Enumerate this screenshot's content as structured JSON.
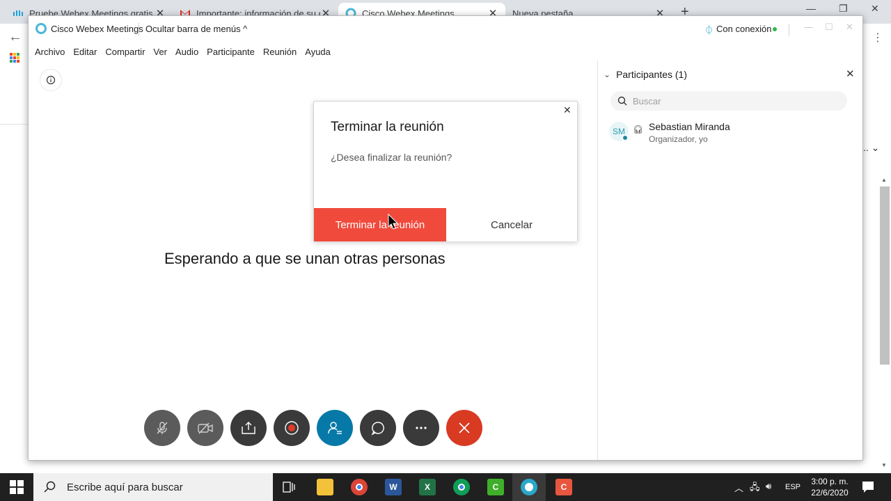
{
  "browser": {
    "tabs": [
      {
        "label": "Pruebe Webex Meetings gratis | ..."
      },
      {
        "label": "Importante: información de su cu..."
      },
      {
        "label": "Cisco Webex Meetings"
      },
      {
        "label": "Nueva pestaña"
      }
    ],
    "new_tab": "+"
  },
  "webex": {
    "app_name": "Cisco Webex Meetings",
    "hide_menu": "Ocultar barra de menús ^",
    "connection": "Con conexión",
    "menu": [
      "Archivo",
      "Editar",
      "Compartir",
      "Ver",
      "Audio",
      "Participante",
      "Reunión",
      "Ayuda"
    ],
    "waiting_text": "Esperando a que se unan otras personas",
    "controls": [
      "mute-button",
      "video-button",
      "share-button",
      "record-button",
      "participants-button",
      "chat-button",
      "more-button",
      "end-meeting-button"
    ]
  },
  "panel": {
    "title": "Participantes (1)",
    "search_placeholder": "Buscar",
    "participants": [
      {
        "initials": "SM",
        "name": "Sebastian Miranda",
        "role": "Organizador, yo"
      }
    ]
  },
  "dialog": {
    "title": "Terminar la reunión",
    "message": "¿Desea finalizar la reunión?",
    "end_button": "Terminar la reunión",
    "cancel_button": "Cancelar"
  },
  "taskbar": {
    "search_text": "Escribe aquí para buscar",
    "language": "ESP",
    "time": "3:00 p. m.",
    "date": "22/6/2020"
  },
  "colors": {
    "end_red": "#f04a3c",
    "control_blue": "#0779a8",
    "control_red": "#d93a22",
    "connected_green": "#2fb84c"
  }
}
